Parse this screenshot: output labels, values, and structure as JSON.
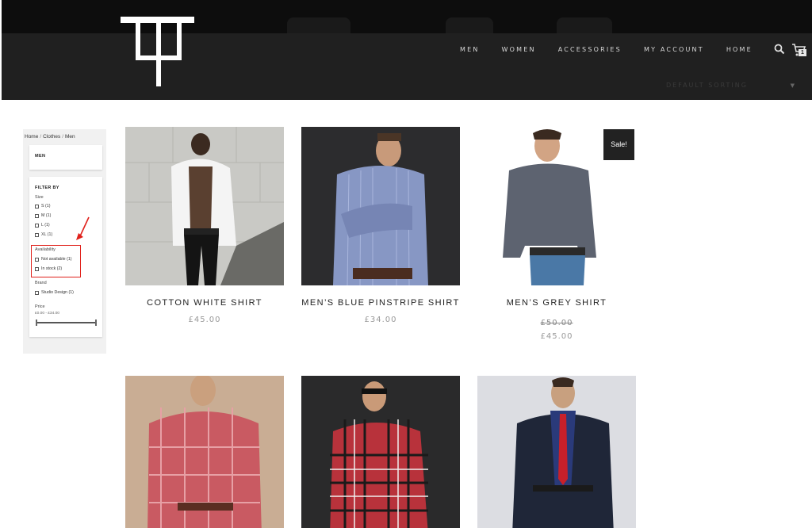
{
  "nav": {
    "items": [
      "MEN",
      "WOMEN",
      "ACCESSORIES",
      "MY ACCOUNT",
      "HOME"
    ],
    "cart_count": "1"
  },
  "sorting": {
    "label": "DEFAULT SORTING"
  },
  "breadcrumb": [
    "Home",
    "Clothes",
    "Men"
  ],
  "sidebar": {
    "category_title": "MEN",
    "filter_title": "FILTER BY",
    "size_title": "Size",
    "sizes": [
      "S (1)",
      "M (1)",
      "L (1)",
      "XL (1)"
    ],
    "availability_title": "Availability",
    "availability": [
      "Not available (1)",
      "In stock (2)"
    ],
    "brand_title": "Brand",
    "brands": [
      "Studio Design (1)"
    ],
    "price_title": "Price",
    "price_range": "£0.00 - £34.00"
  },
  "products": [
    {
      "title": "COTTON WHITE SHIRT",
      "price": "£45.00"
    },
    {
      "title": "MEN’S BLUE PINSTRIPE SHIRT",
      "price": "£34.00"
    },
    {
      "title": "MEN’S GREY SHIRT",
      "old_price": "£50.00",
      "price": "£45.00",
      "badge": "Sale!"
    },
    {
      "title": "",
      "price": ""
    },
    {
      "title": "",
      "price": ""
    },
    {
      "title": "",
      "price": ""
    }
  ],
  "colors": {
    "header": "#202020",
    "highlight": "#e0201a",
    "sale_badge": "#222222"
  }
}
